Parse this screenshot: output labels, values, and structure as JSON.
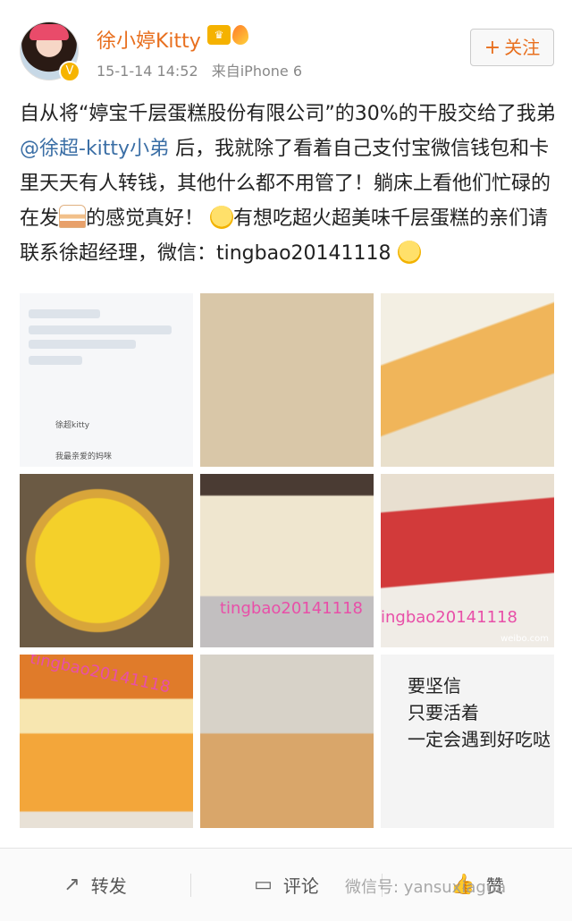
{
  "post": {
    "username": "徐小婷Kitty",
    "vip_badge": "♛",
    "timestamp": "15-1-14 14:52",
    "source": "来自iPhone 6",
    "follow_label": "关注",
    "text_part1": "自从将“婷宝千层蛋糕股份有限公司”的30%的干股交给了我弟",
    "mention": "@徐超-kitty小弟",
    "text_part2": " 后，我就除了看着自己支付宝微信钱包和卡里天天有人转钱，其他什么都不用管了！躺床上看他们忙碌的在发",
    "text_part3": "的感觉真好！",
    "text_part4": "有想吃超火超美味千层蛋糕的亲们请联系徐超经理，微信：tingbao20141118"
  },
  "images": {
    "watermark_1": "tingbao20141118",
    "watermark_2": "ingbao20141118",
    "watermark_3": "tingbao20141118",
    "weibo_mark": "weibo.com",
    "note_line1": "要坚信",
    "note_line2": "只要活着",
    "note_line3": "一定会遇到好吃哒",
    "chat_name": "徐超kitty",
    "chat_line": "我最亲爱的妈咪"
  },
  "actions": {
    "repost_label": "转发",
    "comment_label": "评论",
    "like_label": "赞"
  },
  "overlay": {
    "wechat_watermark": "微信号: yansuxiagua"
  },
  "colors": {
    "username": "#e86f1e",
    "mention": "#3a6ea5",
    "watermark": "#e84fa8"
  }
}
